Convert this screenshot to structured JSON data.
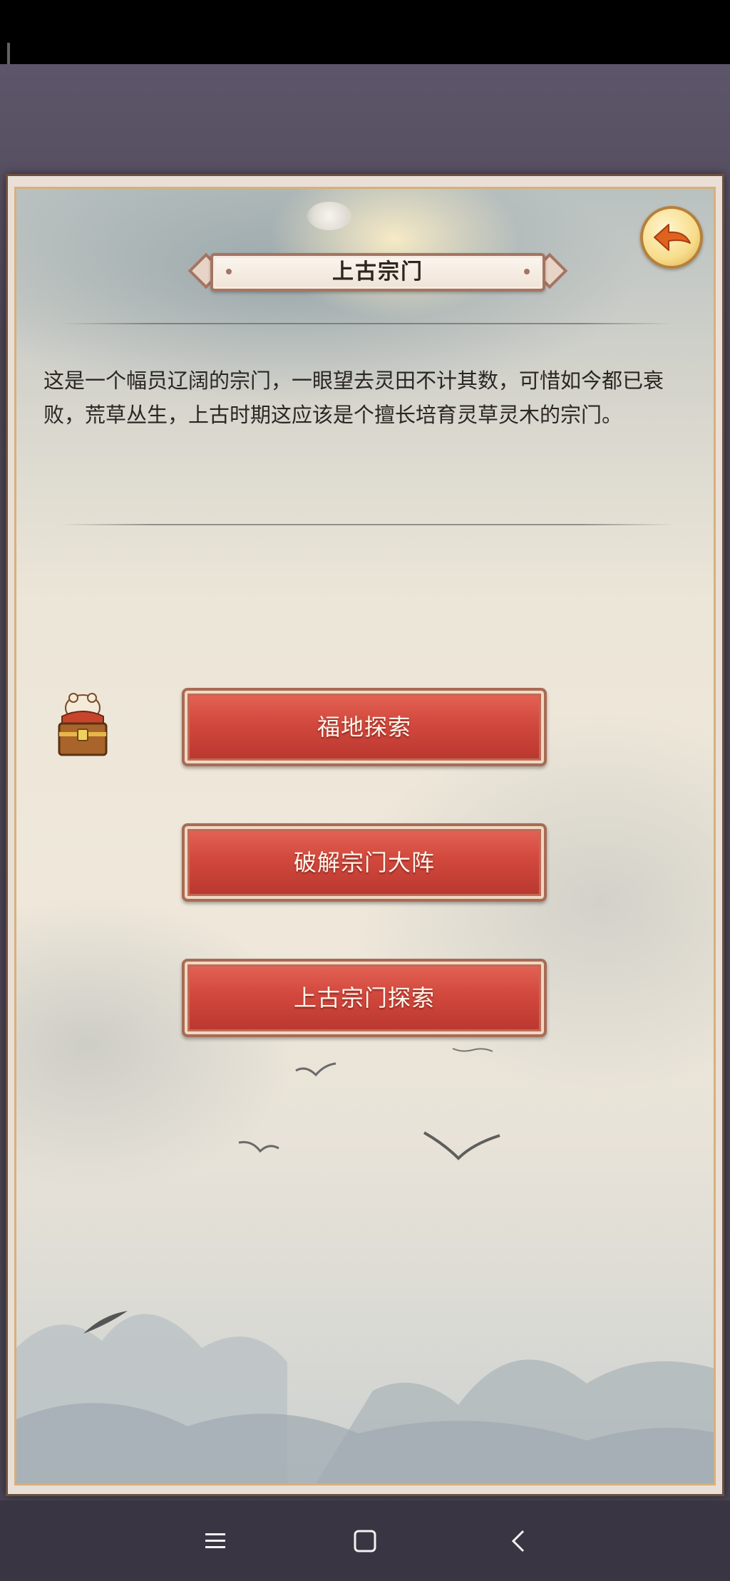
{
  "panel": {
    "title": "上古宗门",
    "description": "这是一个幅员辽阔的宗门，一眼望去灵田不计其数，可惜如今都已衰败，荒草丛生，上古时期这应该是个擅长培育灵草灵木的宗门。"
  },
  "actions": [
    {
      "label": "福地探索"
    },
    {
      "label": "破解宗门大阵"
    },
    {
      "label": "上古宗门探索"
    }
  ],
  "icons": {
    "back": "back-arrow-icon",
    "chest": "treasure-chest-icon",
    "nav_menu": "menu-icon",
    "nav_home": "home-square-icon",
    "nav_back": "back-chevron-icon"
  },
  "colors": {
    "button_red": "#d2483d",
    "back_button_gold": "#f7dc8a",
    "frame_brown": "#a47562"
  }
}
